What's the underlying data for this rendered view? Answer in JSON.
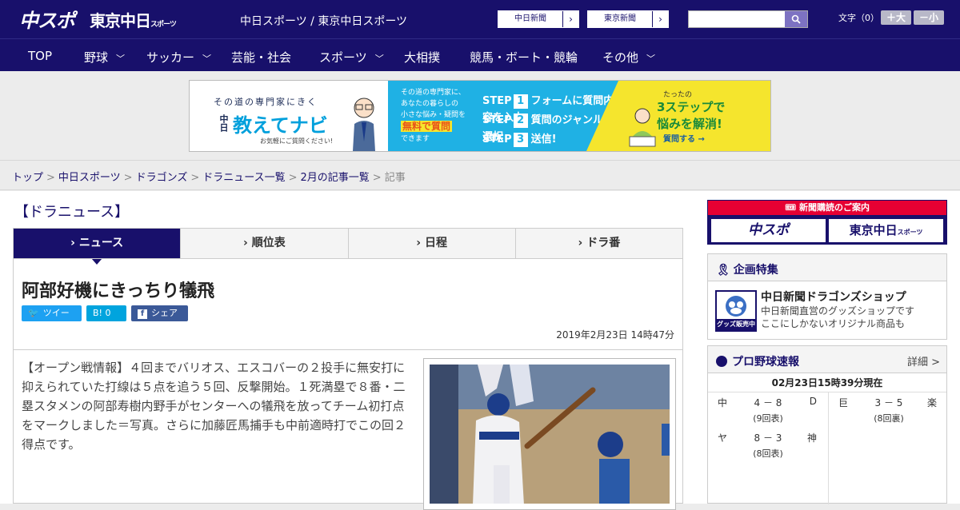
{
  "header": {
    "logo_chuspo": "中スポ",
    "logo_tokyo": "東京中日",
    "logo_tokyo_sub": "スポーツ",
    "site_link": "中日スポーツ / 東京中日スポーツ",
    "btn_chunichi": "中日新聞",
    "btn_tokyo": "東京新聞",
    "arrow": "›",
    "search_placeholder": "",
    "font_size_label": "文字（0）",
    "font_plus": "＋大",
    "font_minus": "－小"
  },
  "nav": [
    "TOP",
    "野球",
    "サッカー",
    "芸能・社会",
    "スポーツ",
    "大相撲",
    "競馬・ボート・競輪",
    "その他"
  ],
  "banner": {
    "tag": "その道の専門家にきく",
    "brand_small": "中日",
    "brand": "教えてナビ",
    "note": "お気軽にご質問ください!",
    "intro1": "その道の専門家に、",
    "intro2": "あなたの暮らしの",
    "intro3": "小さな悩み・疑問を",
    "free": "無料で質問",
    "intro4": "できます",
    "step_label": "STEP",
    "step1": "フォームに質問内容を入力",
    "step2": "質問のジャンルを選択",
    "step3": "送信!",
    "right1": "たったの",
    "right2": "3ステップで",
    "right3": "悩みを解消!",
    "right4": "質問する →"
  },
  "breadcrumb": [
    "トップ",
    "中日スポーツ",
    "ドラゴンズ",
    "ドラニュース一覧",
    "2月の記事一覧"
  ],
  "breadcrumb_current": "記事",
  "breadcrumb_sep": ">",
  "section_title": "【ドラニュース】",
  "tabs": [
    "ニュース",
    "順位表",
    "日程",
    "ドラ番"
  ],
  "tab_arrow": "›",
  "article": {
    "title": "阿部好機にきっちり犠飛",
    "tweet": "ツイート",
    "hatena": "B! 0",
    "share": "シェア 0",
    "date": "2019年2月23日 14時47分",
    "body": "【オープン戦情報】４回までバリオス、エスコバーの２投手に無安打に抑えられていた打線は５点を追う５回、反撃開始。１死満塁で８番・二塁スタメンの阿部寿樹内野手がセンターへの犠飛を放ってチーム初打点をマークしました＝写真。さらに加藤匠馬捕手も中前適時打でこの回２得点です。"
  },
  "sidebar": {
    "subscribe_label": "新聞購読のご案内",
    "sub_chuspo": "中スポ",
    "sub_tokyo": "東京中日",
    "sub_tokyo_small": "スポーツ",
    "kikaku_title": "企画特集",
    "shop_title": "中日新聞ドラゴンズショップ",
    "shop_desc1": "中日新聞直営のグッズショップです",
    "shop_desc2": "ここにしかないオリジナル商品も",
    "shop_badge": "グッズ販売中",
    "scores_title": "プロ野球速報",
    "scores_more": "詳細 >",
    "scores_time": "02月23日15時39分現在",
    "games": [
      {
        "team1": "中",
        "score": "4 － 8",
        "team2": "D",
        "inning": "(9回表)"
      },
      {
        "team1": "ヤ",
        "score": "8 － 3",
        "team2": "神",
        "inning": "(8回表)"
      },
      {
        "team1": "巨",
        "score": "3 － 5",
        "team2": "楽",
        "inning": "(8回裏)"
      }
    ]
  },
  "colors": {
    "navy": "#18106b",
    "red": "#e60033",
    "twitter": "#1da1f2",
    "hatena": "#00a4de",
    "facebook": "#3b5998"
  }
}
